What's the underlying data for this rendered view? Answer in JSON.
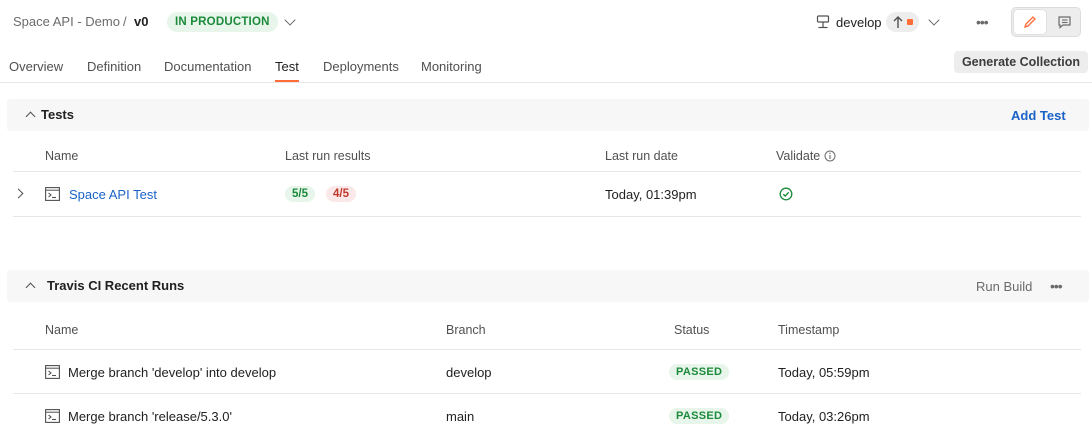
{
  "header": {
    "breadcrumb_api": "Space API - Demo",
    "breadcrumb_sep": "/",
    "version": "v0",
    "status": "IN PRODUCTION",
    "branch": "develop"
  },
  "tabs": [
    {
      "label": "Overview"
    },
    {
      "label": "Definition"
    },
    {
      "label": "Documentation"
    },
    {
      "label": "Test"
    },
    {
      "label": "Deployments"
    },
    {
      "label": "Monitoring"
    }
  ],
  "active_tab": "Test",
  "toolbar": {
    "generate_collection": "Generate Collection"
  },
  "tests": {
    "title": "Tests",
    "add_label": "Add Test",
    "columns": [
      "Name",
      "Last run results",
      "Last run date",
      "Validate"
    ],
    "rows": [
      {
        "name": "Space API Test",
        "passed": "5/5",
        "failed": "4/5",
        "date": "Today, 01:39pm",
        "validated": true
      }
    ]
  },
  "travis": {
    "title": "Travis CI Recent Runs",
    "run_build_label": "Run Build",
    "columns": [
      "Name",
      "Branch",
      "Status",
      "Timestamp"
    ],
    "rows": [
      {
        "name": "Merge branch 'develop' into develop",
        "branch": "develop",
        "status": "PASSED",
        "timestamp": "Today, 05:59pm"
      },
      {
        "name": "Merge branch 'release/5.3.0'",
        "branch": "main",
        "status": "PASSED",
        "timestamp": "Today, 03:26pm"
      }
    ]
  },
  "colors": {
    "accent": "#ff6c37",
    "link": "#1a63c7",
    "success": "#1b8a3a",
    "danger": "#c0392b"
  }
}
